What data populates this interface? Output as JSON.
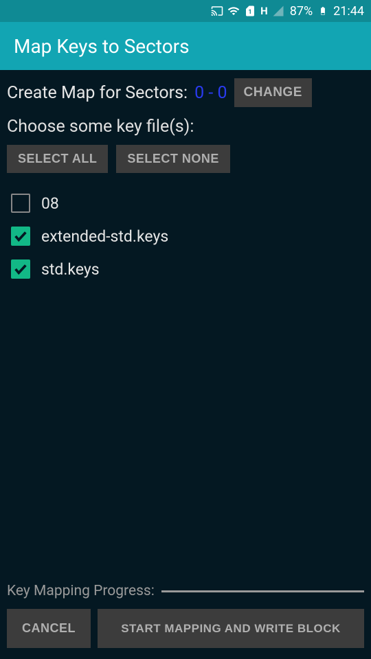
{
  "status": {
    "battery_pct": "87%",
    "time": "21:44",
    "net_type": "H"
  },
  "app": {
    "title": "Map Keys to Sectors"
  },
  "sectors": {
    "label": "Create Map for Sectors:",
    "range": "0 - 0",
    "change_label": "CHANGE"
  },
  "choose": {
    "label": "Choose some key file(s):",
    "select_all": "SELECT ALL",
    "select_none": "SELECT NONE"
  },
  "files": [
    {
      "name": "08",
      "checked": false
    },
    {
      "name": "extended-std.keys",
      "checked": true
    },
    {
      "name": "std.keys",
      "checked": true
    }
  ],
  "progress": {
    "label": "Key Mapping Progress:"
  },
  "actions": {
    "cancel": "CANCEL",
    "start": "START MAPPING AND WRITE BLOCK"
  }
}
